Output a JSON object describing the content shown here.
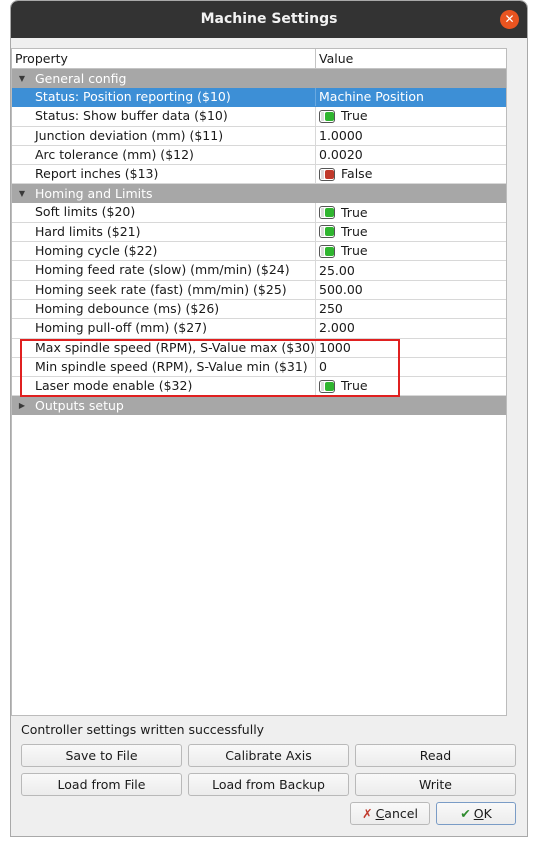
{
  "window": {
    "title": "Machine Settings"
  },
  "tree": {
    "columns": [
      "Property",
      "Value"
    ],
    "groups": [
      {
        "label": "General config",
        "rows": [
          {
            "property": "Status: Position reporting ($10)",
            "value": "Machine Position"
          },
          {
            "property": "Status: Show buffer data ($10)",
            "value": "True"
          },
          {
            "property": "Junction deviation (mm) ($11)",
            "value": "1.0000"
          },
          {
            "property": "Arc tolerance (mm) ($12)",
            "value": "0.0020"
          },
          {
            "property": "Report inches ($13)",
            "value": "False"
          }
        ]
      },
      {
        "label": "Homing and Limits",
        "rows": [
          {
            "property": "Soft limits ($20)",
            "value": "True"
          },
          {
            "property": "Hard limits ($21)",
            "value": "True"
          },
          {
            "property": "Homing cycle ($22)",
            "value": "True"
          },
          {
            "property": "Homing feed rate (slow) (mm/min) ($24)",
            "value": "25.00"
          },
          {
            "property": "Homing seek rate (fast) (mm/min) ($25)",
            "value": "500.00"
          },
          {
            "property": "Homing debounce (ms) ($26)",
            "value": "250"
          },
          {
            "property": "Homing pull-off (mm) ($27)",
            "value": "2.000"
          },
          {
            "property": "Max spindle speed (RPM), S-Value max ($30)",
            "value": "1000"
          },
          {
            "property": "Min spindle speed (RPM), S-Value min ($31)",
            "value": "0"
          },
          {
            "property": "Laser mode enable ($32)",
            "value": "True"
          }
        ]
      },
      {
        "label": "Outputs setup"
      }
    ]
  },
  "status_message": "Controller settings written successfully",
  "buttons": {
    "save_to_file": "Save to File",
    "calibrate_axis": "Calibrate Axis",
    "read": "Read",
    "load_from_file": "Load from File",
    "load_from_backup": "Load from Backup",
    "write": "Write",
    "cancel_prefix": "",
    "cancel_u": "C",
    "cancel_rest": "ancel",
    "ok_u": "O",
    "ok_rest": "K"
  },
  "icons": {
    "close": "close-icon",
    "cancel": "x-icon",
    "ok": "check-icon",
    "toggle_on_color": "#2fb52f",
    "toggle_off_color": "#c0392b"
  },
  "colors": {
    "selection": "#3d8fd6",
    "group_header": "#a7a7a7",
    "highlight_box": "#e02020",
    "close_button": "#e95420"
  }
}
